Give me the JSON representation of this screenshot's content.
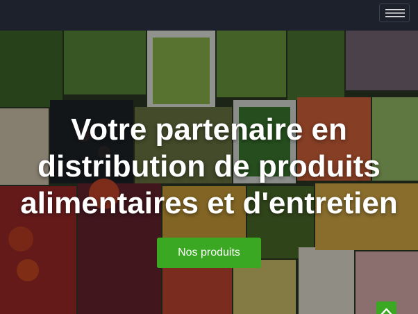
{
  "navbar": {
    "menu_icon": "hamburger-menu-icon"
  },
  "hero": {
    "title_lines": [
      "Votre partenaire en",
      "distribution de produits",
      "alimentaires et d'entretien"
    ],
    "cta_label": "Nos produits"
  },
  "back_to_top": {
    "icon": "chevron-up-icon"
  },
  "colors": {
    "navbar": "#1c212b",
    "accent": "#3aa822",
    "text": "#ffffff"
  }
}
